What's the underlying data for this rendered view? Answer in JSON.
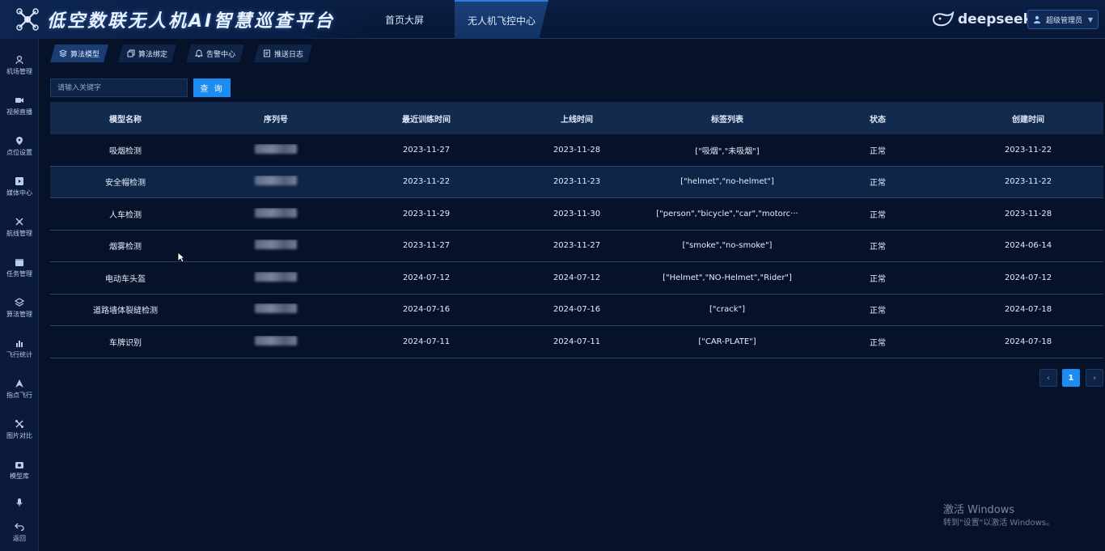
{
  "header": {
    "app_title": "低空数联无人机AI智慧巡查平台",
    "nav": [
      "首页大屏",
      "无人机飞控中心"
    ],
    "brand": "deepseek",
    "user": "超级管理员"
  },
  "sidebar": {
    "items": [
      {
        "label": "机场管理",
        "icon": "airport-icon"
      },
      {
        "label": "视频直播",
        "icon": "video-icon"
      },
      {
        "label": "点位设置",
        "icon": "location-pin-icon"
      },
      {
        "label": "媒体中心",
        "icon": "media-icon"
      },
      {
        "label": "航线管理",
        "icon": "route-icon"
      },
      {
        "label": "任务管理",
        "icon": "task-icon"
      },
      {
        "label": "算法管理",
        "icon": "algorithm-icon"
      },
      {
        "label": "飞行统计",
        "icon": "bar-chart-icon"
      },
      {
        "label": "指点飞行",
        "icon": "drone-pointer-icon"
      },
      {
        "label": "图片对比",
        "icon": "image-compare-icon"
      },
      {
        "label": "模型库",
        "icon": "model-library-icon"
      },
      {
        "label": "",
        "icon": "microphone-icon"
      },
      {
        "label": "返回",
        "icon": "return-icon"
      }
    ]
  },
  "subtabs": [
    "算法模型",
    "算法绑定",
    "告警中心",
    "推送日志"
  ],
  "search": {
    "placeholder": "请输入关键字",
    "button": "查 询"
  },
  "table": {
    "columns": [
      "模型名称",
      "序列号",
      "最近训练时间",
      "上线时间",
      "标签列表",
      "状态",
      "创建时间"
    ],
    "rows": [
      {
        "name": "吸烟检测",
        "trained": "2023-11-27",
        "online": "2023-11-28",
        "tags": "[\"吸烟\",\"未吸烟\"]",
        "status": "正常",
        "created": "2023-11-22"
      },
      {
        "name": "安全帽检测",
        "trained": "2023-11-22",
        "online": "2023-11-23",
        "tags": "[\"helmet\",\"no-helmet\"]",
        "status": "正常",
        "created": "2023-11-22"
      },
      {
        "name": "人车检测",
        "trained": "2023-11-29",
        "online": "2023-11-30",
        "tags": "[\"person\",\"bicycle\",\"car\",\"motorc···",
        "status": "正常",
        "created": "2023-11-28"
      },
      {
        "name": "烟雾检测",
        "trained": "2023-11-27",
        "online": "2023-11-27",
        "tags": "[\"smoke\",\"no-smoke\"]",
        "status": "正常",
        "created": "2024-06-14"
      },
      {
        "name": "电动车头盔",
        "trained": "2024-07-12",
        "online": "2024-07-12",
        "tags": "[\"Helmet\",\"NO-Helmet\",\"Rider\"]",
        "status": "正常",
        "created": "2024-07-12"
      },
      {
        "name": "道路墙体裂缝检测",
        "trained": "2024-07-16",
        "online": "2024-07-16",
        "tags": "[\"crack\"]",
        "status": "正常",
        "created": "2024-07-18"
      },
      {
        "name": "车牌识别",
        "trained": "2024-07-11",
        "online": "2024-07-11",
        "tags": "[\"CAR-PLATE\"]",
        "status": "正常",
        "created": "2024-07-18"
      }
    ]
  },
  "pagination": {
    "current": "1",
    "prev": "‹",
    "next": "›"
  },
  "watermark": {
    "line1": "激活 Windows",
    "line2": "转到\"设置\"以激活 Windows。"
  },
  "colors": {
    "accent": "#1a8cf2",
    "background": "#06122a",
    "header": "#0b1f44"
  }
}
